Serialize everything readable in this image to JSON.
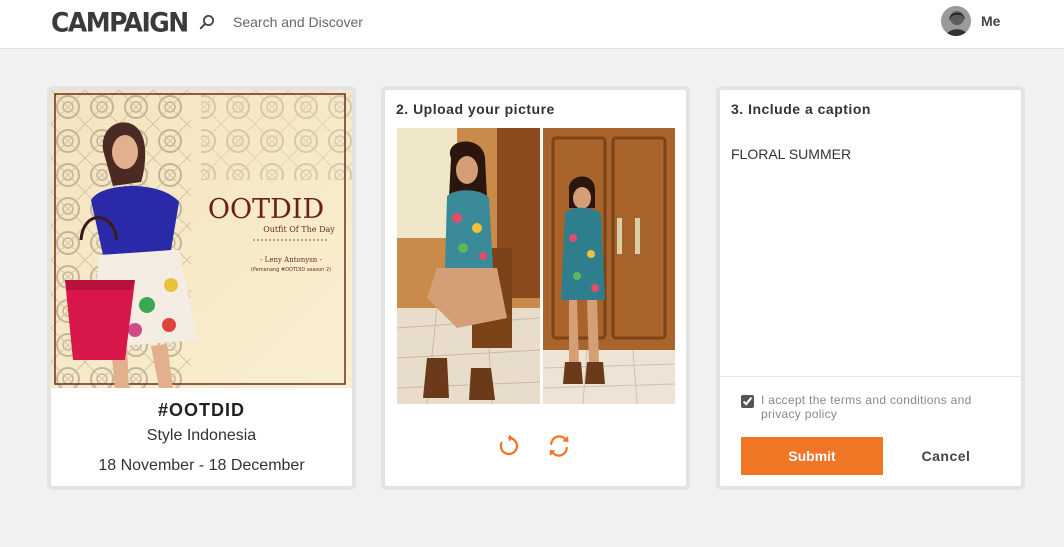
{
  "header": {
    "logo": "CAMPAIGN",
    "search_placeholder": "Search and Discover",
    "user_label": "Me"
  },
  "campaign_card": {
    "banner": {
      "headline": "OOTDID",
      "tagline": "Outfit Of The Day",
      "credit_name": "- Leny Antonysn -",
      "credit_note": "(Pemenang #OOTDID season 2)"
    },
    "title": "#OOTDID",
    "subtitle": "Style Indonesia",
    "dates": "18 November - 18 December"
  },
  "upload_card": {
    "heading": "2. Upload your picture"
  },
  "caption_card": {
    "heading": "3. Include a caption",
    "caption": "FLORAL SUMMER",
    "terms_label": "I accept the terms and conditions and privacy policy",
    "terms_checked": true,
    "submit_label": "Submit",
    "cancel_label": "Cancel"
  },
  "colors": {
    "accent": "#f07524",
    "background": "#f1f1f1"
  },
  "icons": [
    "search-icon",
    "rotate-left-icon",
    "rotate-right-icon"
  ]
}
